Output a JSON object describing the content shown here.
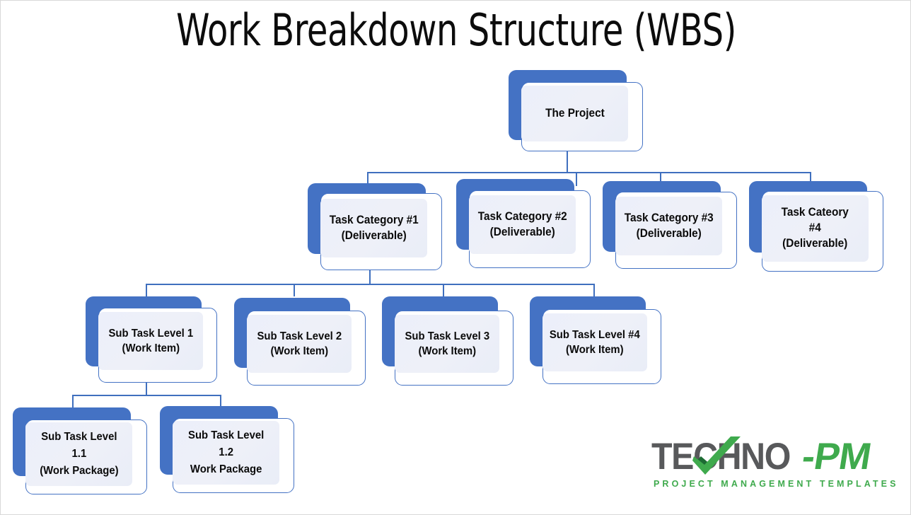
{
  "page": {
    "title": "Work Breakdown Structure (WBS)",
    "background_color": "#ffffff",
    "border_color": "#d8d8d8"
  },
  "theme": {
    "node_blue": "#4472c4",
    "node_panel_fill": "#edf0f8",
    "node_frame_border": "#4472c4",
    "connector_color": "#3f6fbe",
    "text_color": "#0b0b0b",
    "logo_gray": "#58595b",
    "logo_green": "#3faa4d"
  },
  "diagram": {
    "type": "work-breakdown-structure",
    "levels": [
      {
        "level": 0,
        "nodes": [
          {
            "id": "root",
            "label": "The Project"
          }
        ]
      },
      {
        "level": 1,
        "nodes": [
          {
            "id": "cat1",
            "label": "Task Category #1\n(Deliverable)"
          },
          {
            "id": "cat2",
            "label": "Task Category #2\n(Deliverable)"
          },
          {
            "id": "cat3",
            "label": "Task Category #3\n(Deliverable)"
          },
          {
            "id": "cat4",
            "label": "Task Cateory\n#4\n(Deliverable)"
          }
        ]
      },
      {
        "level": 2,
        "nodes": [
          {
            "id": "sub1",
            "label": "Sub Task Level 1\n(Work Item)"
          },
          {
            "id": "sub2",
            "label": "Sub Task Level 2\n(Work Item)"
          },
          {
            "id": "sub3",
            "label": "Sub Task Level 3\n(Work Item)"
          },
          {
            "id": "sub4",
            "label": "Sub Task Level #4\n(Work Item)"
          }
        ]
      },
      {
        "level": 3,
        "nodes": [
          {
            "id": "wp11",
            "label": "Sub Task Level\n1.1\n(Work Package)"
          },
          {
            "id": "wp12",
            "label": "Sub Task Level\n1.2\nWork Package"
          }
        ]
      }
    ],
    "edges": [
      {
        "from": "root",
        "to": "cat1"
      },
      {
        "from": "root",
        "to": "cat2"
      },
      {
        "from": "root",
        "to": "cat3"
      },
      {
        "from": "root",
        "to": "cat4"
      },
      {
        "from": "cat1",
        "to": "sub1"
      },
      {
        "from": "cat1",
        "to": "sub2"
      },
      {
        "from": "cat1",
        "to": "sub3"
      },
      {
        "from": "cat1",
        "to": "sub4"
      },
      {
        "from": "sub1",
        "to": "wp11"
      },
      {
        "from": "sub1",
        "to": "wp12"
      }
    ]
  },
  "logo": {
    "word_techno": "TECHNO",
    "word_dash": "-",
    "word_pm": "PM",
    "tagline": "PROJECT MANAGEMENT TEMPLATES",
    "check_icon": "checkmark-icon"
  }
}
